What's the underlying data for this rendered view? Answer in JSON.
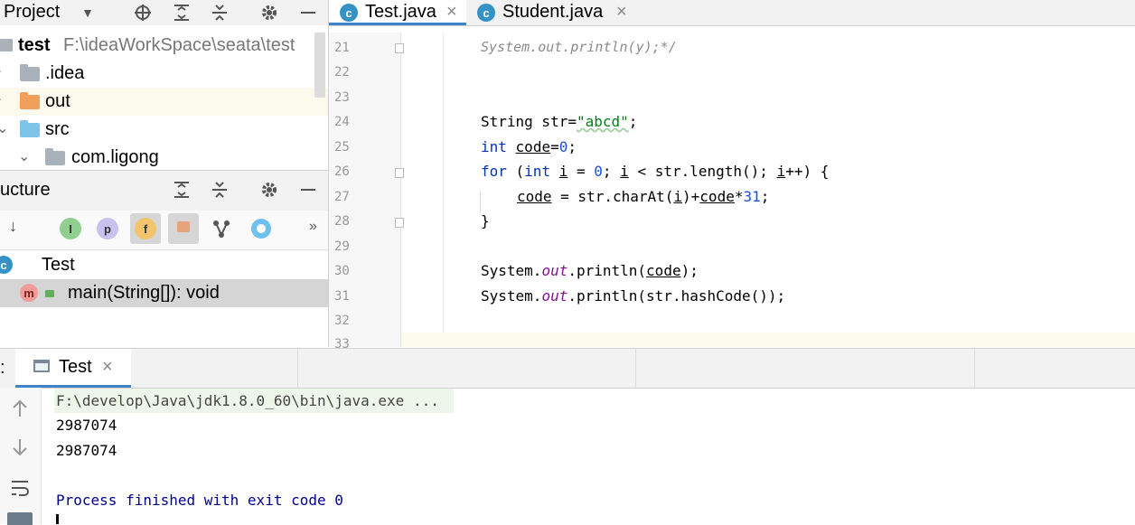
{
  "project_panel": {
    "title": "Project",
    "root": {
      "name": "test",
      "path": "F:\\ideaWorkSpace\\seata\\test"
    },
    "items": [
      {
        "label": ".idea",
        "folder_color": "#a9b1ba"
      },
      {
        "label": "out",
        "folder_color": "#f0a05a"
      },
      {
        "label": "src",
        "folder_color": "#7ec3e8"
      },
      {
        "label": "com.ligong",
        "folder_color": "#a9b1ba"
      }
    ]
  },
  "structure_panel": {
    "title": "ucture",
    "toolbar_icons": [
      "sort-alpha-icon",
      "inherited-icon",
      "property-icon",
      "field-icon",
      "lock-icon",
      "anonymous-icon",
      "lambda-icon",
      "more-icon"
    ],
    "icon_glyphs": {
      "sort": "↓",
      "inherited": "I",
      "property": "p",
      "field": "f",
      "more": "»"
    },
    "items": [
      {
        "label": "Test",
        "icon_letter": "c"
      },
      {
        "label": "main(String[]): void",
        "icon_letter": "m"
      }
    ]
  },
  "editor": {
    "tabs": [
      {
        "label": "Test.java",
        "active": true,
        "icon_letter": "c"
      },
      {
        "label": "Student.java",
        "active": false,
        "icon_letter": "c"
      }
    ],
    "close_glyph": "×",
    "line_numbers": [
      "21",
      "22",
      "23",
      "24",
      "25",
      "26",
      "27",
      "28",
      "29",
      "30",
      "31",
      "32",
      "33"
    ],
    "lines": {
      "l21": "System.out.println(y);*/",
      "l24_a": "String str=",
      "l24_s": "\"abcd\"",
      "l24_b": ";",
      "l25_kw": "int",
      "l25_var": "code",
      "l25_eq": "=",
      "l25_num": "0",
      "l25_end": ";",
      "l26_for": "for",
      "l26_p1": " (",
      "l26_int": "int",
      "l26_sp": " ",
      "l26_i1": "i",
      "l26_eq": " = ",
      "l26_zero": "0",
      "l26_sc": "; ",
      "l26_i2": "i",
      "l26_mid": " < str.length(); ",
      "l26_i3": "i",
      "l26_end": "++) {",
      "l27_code": "code",
      "l27_mid": " = str.charAt(",
      "l27_i": "i",
      "l27_plus": ")+",
      "l27_code2": "code",
      "l27_mul": "*",
      "l27_num": "31",
      "l27_end": ";",
      "l28": "}",
      "l30_a": "System.",
      "l30_out": "out",
      "l30_b": ".println(",
      "l30_code": "code",
      "l30_c": ");",
      "l31_a": "System.",
      "l31_out": "out",
      "l31_b": ".println(str.hashCode());"
    }
  },
  "run_panel": {
    "prefix": ":",
    "tab_label": "Test",
    "close_glyph": "×",
    "command": "F:\\develop\\Java\\jdk1.8.0_60\\bin\\java.exe ...",
    "output": [
      "2987074",
      "2987074"
    ],
    "finish": "Process finished with exit code 0"
  },
  "colors": {
    "accent": "#4083c9",
    "selection": "#d5d5d5",
    "current_line": "#fcfaed",
    "command_bg": "#eef5e9"
  }
}
